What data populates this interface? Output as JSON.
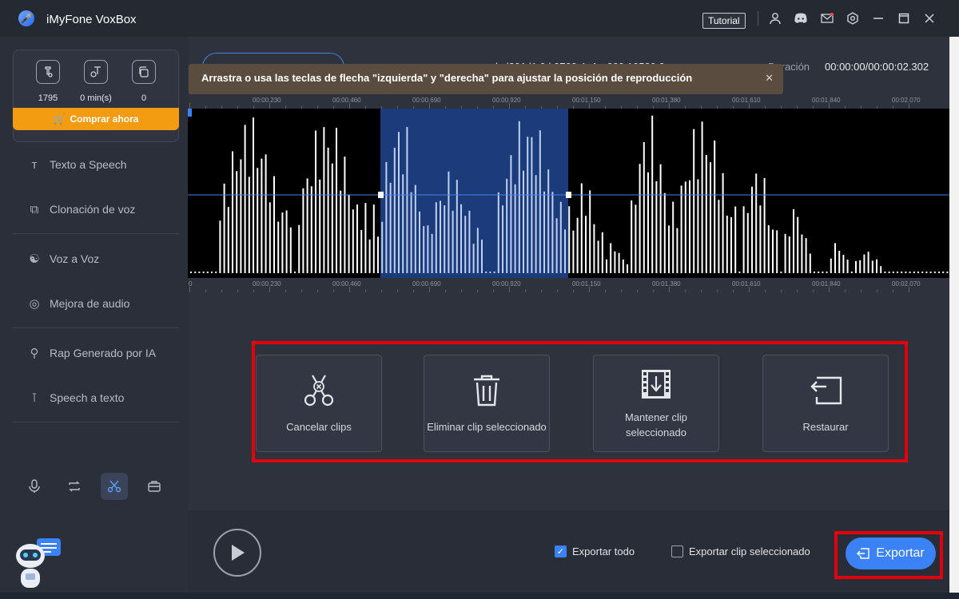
{
  "app": {
    "title": "iMyFone VoxBox",
    "tutorial_label": "Tutorial"
  },
  "titlebar_icons": [
    "user-icon",
    "discord-icon",
    "mail-icon",
    "settings-icon",
    "minimize-icon",
    "maximize-icon",
    "close-icon"
  ],
  "stats": [
    {
      "icon": "text-speech-icon",
      "value": "1795"
    },
    {
      "icon": "time-icon",
      "value": "0 min(s)"
    },
    {
      "icon": "copy-icon",
      "value": "0"
    }
  ],
  "buy_label": "Comprar ahora",
  "nav": [
    {
      "label": "Texto a Speech"
    },
    {
      "label": "Clonación de voz"
    },
    {
      "label": "Voz a Voz"
    },
    {
      "label": "Mejora de audio"
    },
    {
      "label": "Rap Generado por IA"
    },
    {
      "label": "Speech a texto"
    }
  ],
  "file_name": "ls-l391 l1 9 l 0700 4 -1 - 000 10500 0",
  "duration_label": "Duración",
  "duration_value": "00:00:00/00:00:02.302",
  "tooltip": "Arrastra o usa las teclas de flecha \"izquierda\" y \"derecha\" para ajustar la posición de reproducción",
  "ruler_ticks": [
    "00:00.230",
    "00:00.460",
    "00:00.690",
    "00:00.920",
    "00:01.150",
    "00:01.380",
    "00:01.610",
    "00:01.840",
    "00:02.070"
  ],
  "ruler_zero": "0",
  "actions": [
    {
      "label": "Cancelar clips",
      "icon": "scissors-icon"
    },
    {
      "label": "Eliminar clip seleccionado",
      "icon": "trash-icon"
    },
    {
      "label": "Mantener clip seleccionado",
      "icon": "film-download-icon"
    },
    {
      "label": "Restaurar",
      "icon": "restore-icon"
    }
  ],
  "export_all_label": "Exportar todo",
  "export_all_checked": true,
  "export_selected_label": "Exportar clip seleccionado",
  "export_selected_checked": false,
  "export_label": "Exportar",
  "colors": {
    "accent": "#3b82f6",
    "buy": "#f39c12",
    "highlight": "#e3000b",
    "selection": "#1c3b7a"
  }
}
